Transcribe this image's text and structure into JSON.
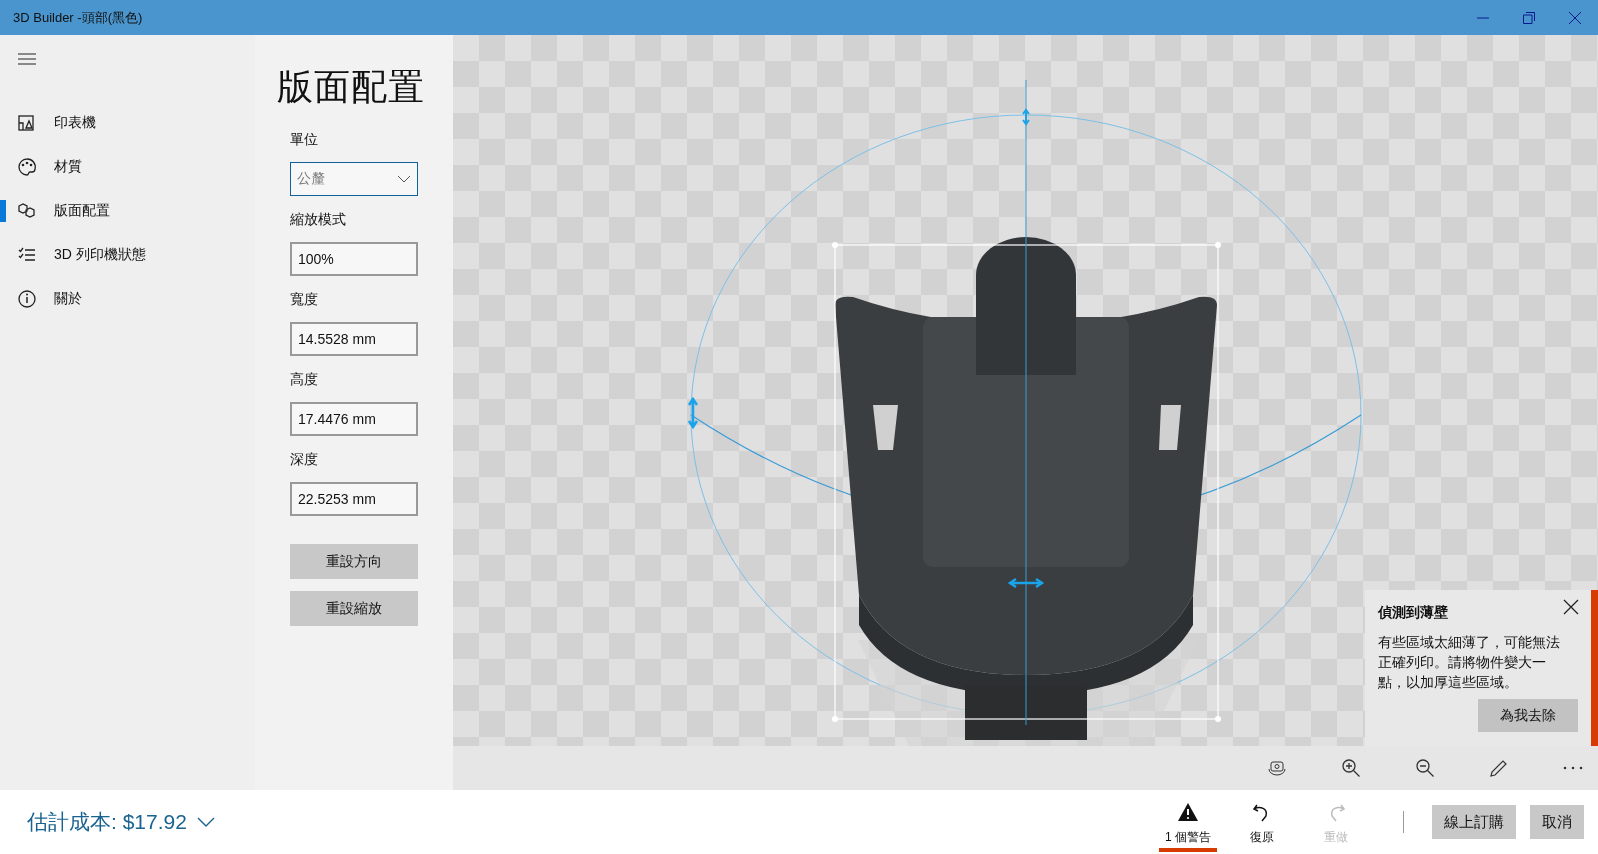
{
  "window": {
    "title": "3D Builder -頭部(黑色)"
  },
  "sidebar": {
    "items": [
      {
        "label": "印表機",
        "selected": false
      },
      {
        "label": "材質",
        "selected": false
      },
      {
        "label": "版面配置",
        "selected": true
      },
      {
        "label": "3D 列印機狀態",
        "selected": false
      },
      {
        "label": "關於",
        "selected": false
      }
    ]
  },
  "panel": {
    "title": "版面配置",
    "fields": [
      {
        "kind": "dropdown",
        "label": "單位",
        "value": "公釐"
      },
      {
        "kind": "input",
        "label": "縮放模式",
        "value": "100%"
      },
      {
        "kind": "input",
        "label": "寬度",
        "value": "14.5528 mm"
      },
      {
        "kind": "input",
        "label": "高度",
        "value": "17.4476 mm"
      },
      {
        "kind": "input",
        "label": "深度",
        "value": "22.5253 mm"
      }
    ],
    "buttons": [
      "重設方向",
      "重設縮放"
    ]
  },
  "notification": {
    "title": "偵測到薄壁",
    "message": "有些區域太細薄了，可能無法正確列印。請將物件變大一點，以加厚這些區域。",
    "button": "為我去除"
  },
  "status_bar": {
    "cost": "估計成本: $17.92",
    "actions": [
      {
        "label": "1 個警告",
        "disabled": false
      },
      {
        "label": "復原",
        "disabled": false
      },
      {
        "label": "重做",
        "disabled": true
      }
    ],
    "buttons": [
      "線上訂購",
      "取消"
    ]
  }
}
